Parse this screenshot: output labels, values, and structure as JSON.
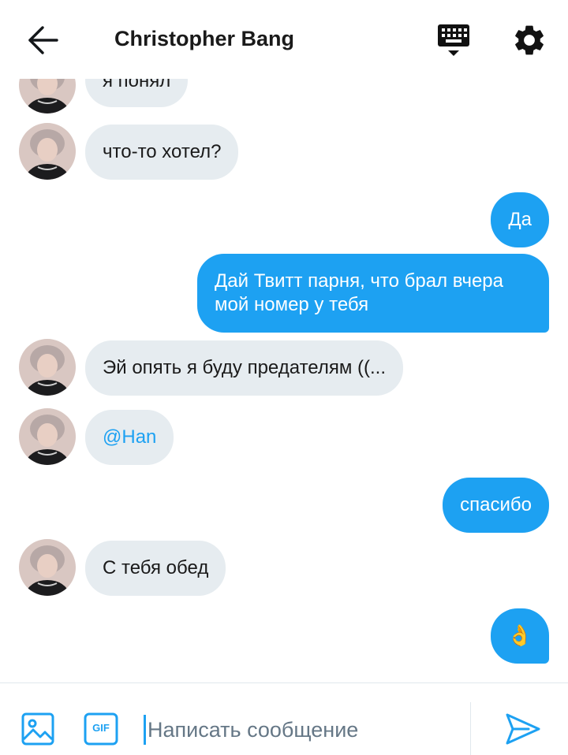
{
  "header": {
    "title": "Christopher Bang",
    "back_icon": "arrow-left-icon",
    "keyboard_icon": "keyboard-icon",
    "settings_icon": "gear-icon"
  },
  "messages": [
    {
      "side": "in",
      "text": "я понял",
      "has_avatar": true
    },
    {
      "side": "in",
      "text": "что-то хотел?",
      "has_avatar": true
    },
    {
      "side": "out",
      "text": "Да"
    },
    {
      "side": "out",
      "lines": [
        "Дай Твитт парня, что брал вчера",
        "мой номер у тебя"
      ]
    },
    {
      "side": "in",
      "text": "Эй опять я буду предателям ((...",
      "has_avatar": true
    },
    {
      "side": "in",
      "text": "@Han",
      "is_mention": true,
      "has_avatar": true
    },
    {
      "side": "out",
      "text": "спасибо"
    },
    {
      "side": "in",
      "text": "С тебя обед",
      "has_avatar": true
    },
    {
      "side": "out",
      "text": "👌",
      "is_emoji": true
    }
  ],
  "composer": {
    "placeholder": "Написать сообщение",
    "value": "",
    "media_icon": "image-icon",
    "gif_label": "GIF",
    "send_icon": "send-icon"
  },
  "colors": {
    "accent": "#1da1f2",
    "incoming_bubble": "#e6ecf0",
    "placeholder": "#657786"
  }
}
